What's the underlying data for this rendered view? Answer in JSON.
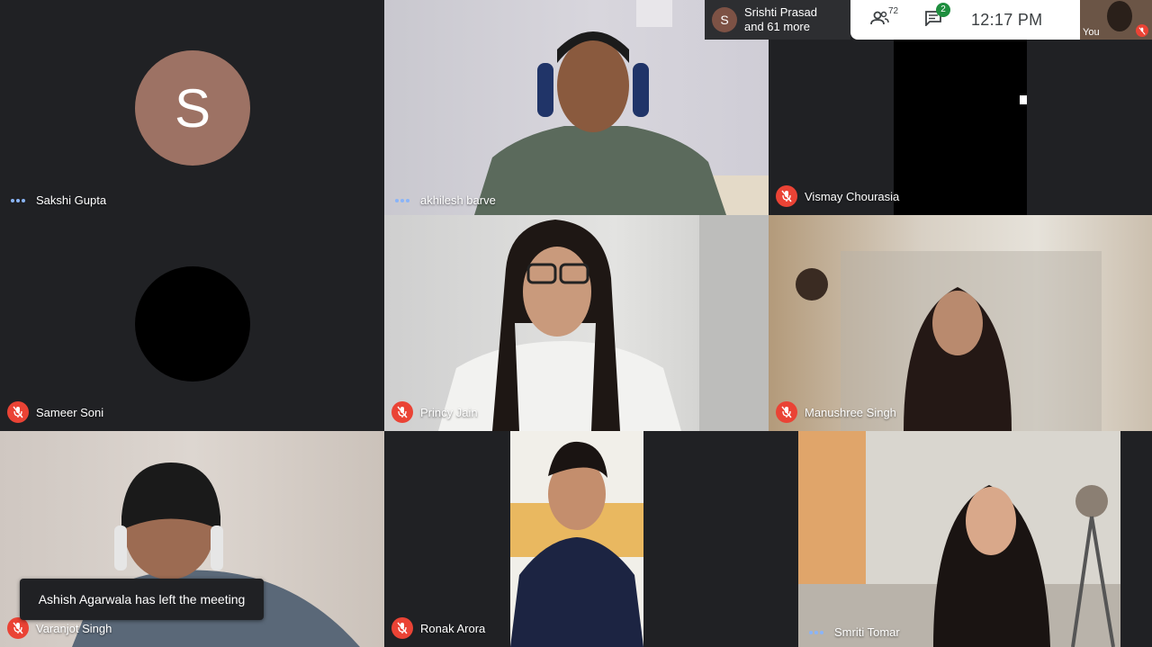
{
  "participants": {
    "sakshi": {
      "name": "Sakshi Gupta",
      "initial": "S",
      "avatar_color": "#9d7264"
    },
    "akhilesh": {
      "name": "akhilesh barve"
    },
    "vismay": {
      "name": "Vismay Chourasia"
    },
    "sameer": {
      "name": "Sameer Soni"
    },
    "princy": {
      "name": "Princy Jain"
    },
    "manushree": {
      "name": "Manushree Singh"
    },
    "varanjot": {
      "name": "Varanjot Singh"
    },
    "ronak": {
      "name": "Ronak Arora"
    },
    "smriti": {
      "name": "Smriti Tomar"
    }
  },
  "topbar": {
    "presenter_initial": "S",
    "presenter_line1": "Srishti Prasad",
    "presenter_line2": "and 61 more",
    "people_count": "72",
    "chat_badge": "2",
    "time": "12:17  PM",
    "self_label": "You"
  },
  "toast": {
    "message": "Ashish Agarwala has left the meeting"
  },
  "colors": {
    "mic_muted": "#ea4335",
    "speaking_dots": "#8ab4f8",
    "chat_badge": "#1e8e3e"
  },
  "icons": [
    "mic-off-icon",
    "more-dots-icon",
    "people-icon",
    "chat-icon"
  ]
}
